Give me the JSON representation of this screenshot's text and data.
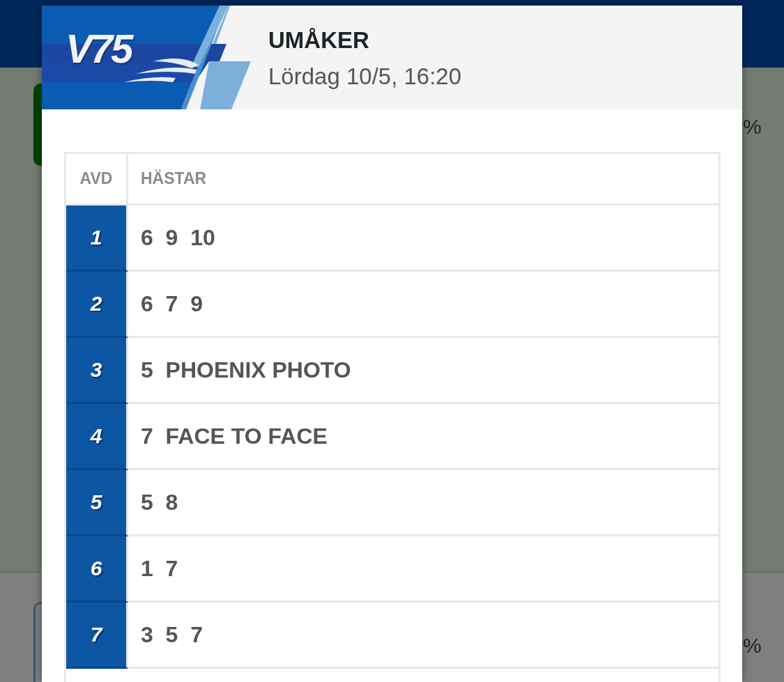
{
  "background": {
    "right_marks": [
      "%",
      "%"
    ]
  },
  "dialog": {
    "logo": "V75",
    "track": "UMÅKER",
    "datetime": "Lördag 10/5, 16:20",
    "table": {
      "columns": [
        "AVD",
        "HÄSTAR"
      ],
      "rows": [
        {
          "leg": "1",
          "horses": "6  9  10"
        },
        {
          "leg": "2",
          "horses": "6  7  9"
        },
        {
          "leg": "3",
          "horses": "5  PHOENIX PHOTO"
        },
        {
          "leg": "4",
          "horses": "7  FACE TO FACE"
        },
        {
          "leg": "5",
          "horses": "5  8"
        },
        {
          "leg": "6",
          "horses": "1  7"
        },
        {
          "leg": "7",
          "horses": "3  5  7"
        }
      ]
    }
  }
}
